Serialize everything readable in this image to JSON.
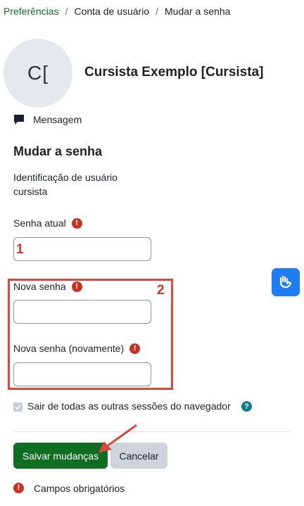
{
  "breadcrumb": {
    "items": [
      "Preferências",
      "Conta de usuário",
      "Mudar a senha"
    ],
    "separator": "/"
  },
  "profile": {
    "avatar_initials": "C[",
    "name": "Cursista Exemplo [Cursista]",
    "message_label": "Mensagem"
  },
  "form": {
    "title": "Mudar a senha",
    "id_label": "Identificação de usuário",
    "id_value": "cursista",
    "current_password_label": "Senha atual",
    "new_password_label": "Nova senha",
    "new_password_again_label": "Nova senha (novamente)",
    "logout_label": "Sair de todas as outras sessões do navegador",
    "save_label": "Salvar mudanças",
    "cancel_label": "Cancelar",
    "required_note": "Campos obrigatórios",
    "required_glyph": "!",
    "help_glyph": "?"
  },
  "annotations": {
    "one": "1",
    "two": "2",
    "color": "#d9493e"
  },
  "colors": {
    "brand_green": "#0f6e21",
    "required_red": "#ca3120",
    "accessibility_blue": "#1e7df0"
  },
  "icons": [
    "message-icon",
    "required-icon",
    "help-icon",
    "accessibility-icon",
    "check-icon",
    "arrow-annotation"
  ]
}
